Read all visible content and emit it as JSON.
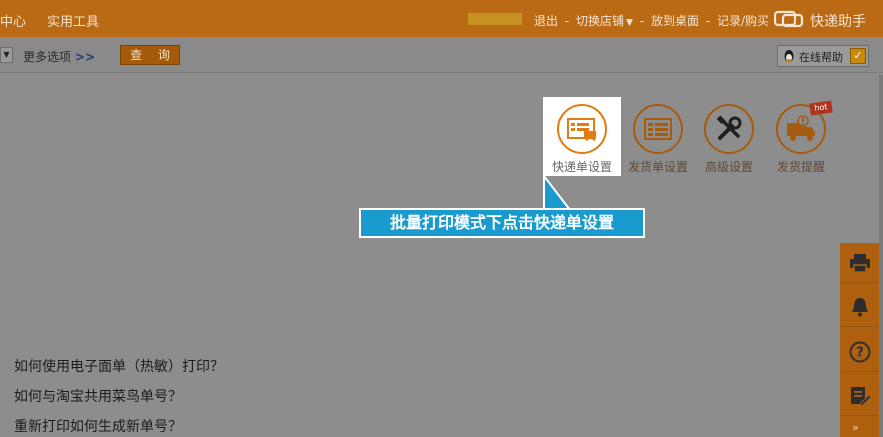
{
  "topbar": {
    "nav_center": "中心",
    "nav_tools": "实用工具",
    "logout": "退出",
    "switch_shop": "切换店铺",
    "put_desktop": "放到桌面",
    "records": "记录/购买",
    "sep": "-",
    "product_title": "快递助手",
    "logo_icon": "kuaidi-logo-icon"
  },
  "toolbar": {
    "more_options": "更多选项",
    "more_arrow": ">>",
    "query_label": "查 询",
    "online_help": "在线帮助",
    "check_mark": "✓"
  },
  "tools": [
    {
      "label": "快递单设置",
      "icon": "express-slip-icon"
    },
    {
      "label": "发货单设置",
      "icon": "invoice-icon"
    },
    {
      "label": "高级设置",
      "icon": "tools-icon"
    },
    {
      "label": "发货提醒",
      "icon": "truck-alert-icon"
    }
  ],
  "hot_badge": "hot",
  "callout": "批量打印模式下点击快递单设置",
  "faq": [
    "如何使用电子面单（热敏）打印？",
    "如何与淘宝共用菜鸟单号？",
    "重新打印如何生成新单号？"
  ],
  "float_bar": [
    "printer-icon",
    "bell-icon",
    "question-icon",
    "edit-note-icon"
  ],
  "colors": {
    "topbar": "#ba6a15",
    "accent": "#e37b13",
    "callout": "#1a9bd0"
  }
}
